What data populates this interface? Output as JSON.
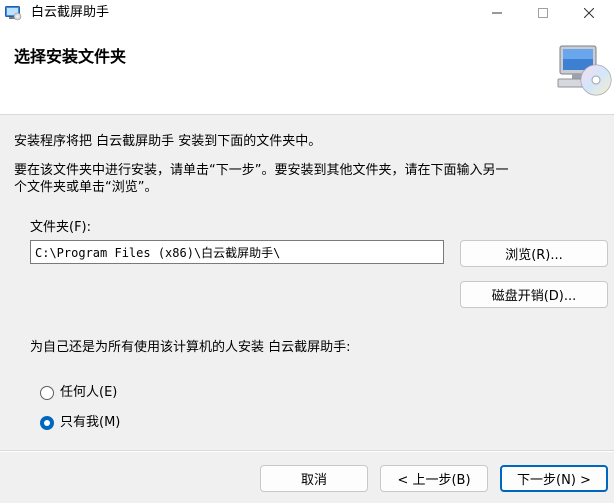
{
  "window": {
    "title": "白云截屏助手",
    "icons": {
      "app": "installer-app-icon",
      "minimize": "minimize-icon",
      "maximize": "maximize-icon",
      "close": "close-icon"
    },
    "accent_color": "#0067c0"
  },
  "header": {
    "title": "选择安装文件夹",
    "icon": "computer-cd-setup-icon"
  },
  "body": {
    "intro": "安装程序将把 白云截屏助手 安装到下面的文件夹中。",
    "instruction_line1": "要在该文件夹中进行安装，请单击“下一步”。要安装到其他文件夹，请在下面输入另一",
    "instruction_line2": "个文件夹或单击“浏览”。",
    "folder_label": "文件夹(F):",
    "folder_value": "C:\\Program Files (x86)\\白云截屏助手\\",
    "browse_label": "浏览(R)...",
    "disk_cost_label": "磁盘开销(D)...",
    "scope_question": "为自己还是为所有使用该计算机的人安装 白云截屏助手:",
    "options": [
      {
        "label": "任何人(E)",
        "selected": false
      },
      {
        "label": "只有我(M)",
        "selected": true
      }
    ]
  },
  "footer": {
    "cancel_label": "取消",
    "back_label": "< 上一步(B)",
    "next_label": "下一步(N) >"
  }
}
